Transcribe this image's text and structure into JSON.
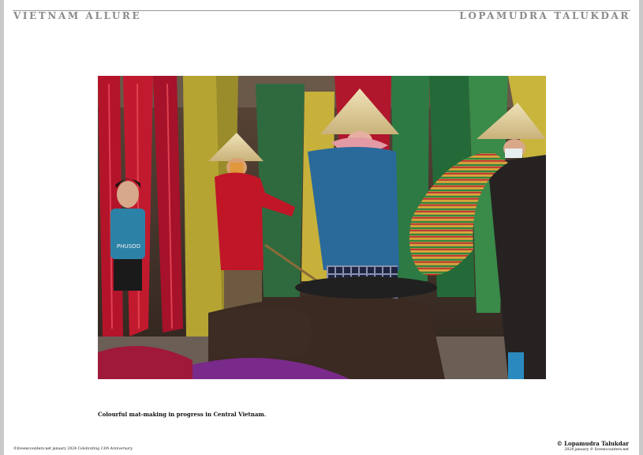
{
  "header": {
    "left": "VIETNAM ALLURE",
    "right": "LOPAMUDRA TALUKDAR"
  },
  "photo": {
    "shirt_text": "PHUSOO"
  },
  "caption": "Colourful mat-making in progress in Central Vietnam.",
  "footer": {
    "left_main": "©liveencounters.net january 2024",
    "left_italic": "Celebrating 13th Anniversary",
    "credit": "© Lopamudra Talukdar",
    "credit_sub": "2024 january © liveencounters.net"
  },
  "colors": {
    "header_text": "#8a8a8a",
    "rule": "#9a9a9a",
    "page_bg": "#ffffff",
    "outer_bg": "#c9c9c9"
  }
}
